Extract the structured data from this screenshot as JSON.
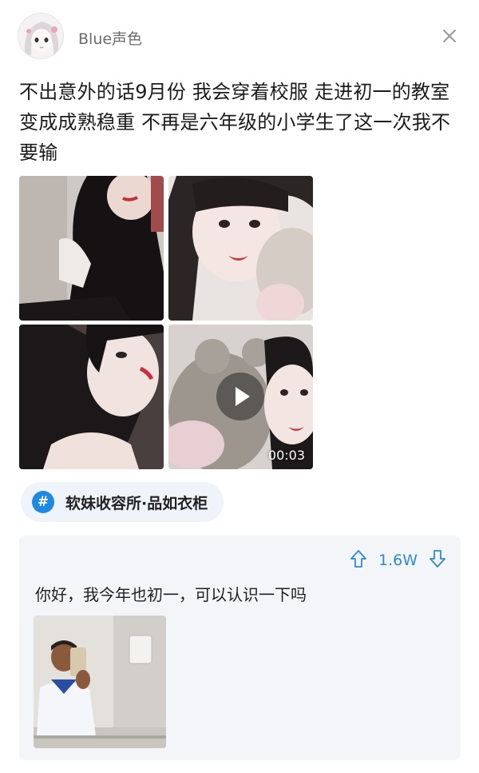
{
  "header": {
    "username": "Blue声色",
    "avatar_icon": "anime-avatar-icon",
    "close_icon": "close-icon"
  },
  "post": {
    "text": "不出意外的话9月份 我会穿着校服 走进初一的教室 变成成熟稳重 不再是六年级的小学生了这一次我不要输"
  },
  "media": {
    "video_duration": "00:03",
    "play_icon": "play-icon"
  },
  "topic": {
    "icon": "#",
    "label": "软妹收容所·品如衣柜"
  },
  "comment": {
    "vote_count": "1.6W",
    "upvote_icon": "upvote-arrow-icon",
    "downvote_icon": "downvote-arrow-icon",
    "text": "你好，我今年也初一，可以认识一下吗"
  },
  "colors": {
    "accent": "#2a8bd8",
    "topic_bg": "#eef4fa",
    "comment_bg": "#f4f5f8"
  }
}
